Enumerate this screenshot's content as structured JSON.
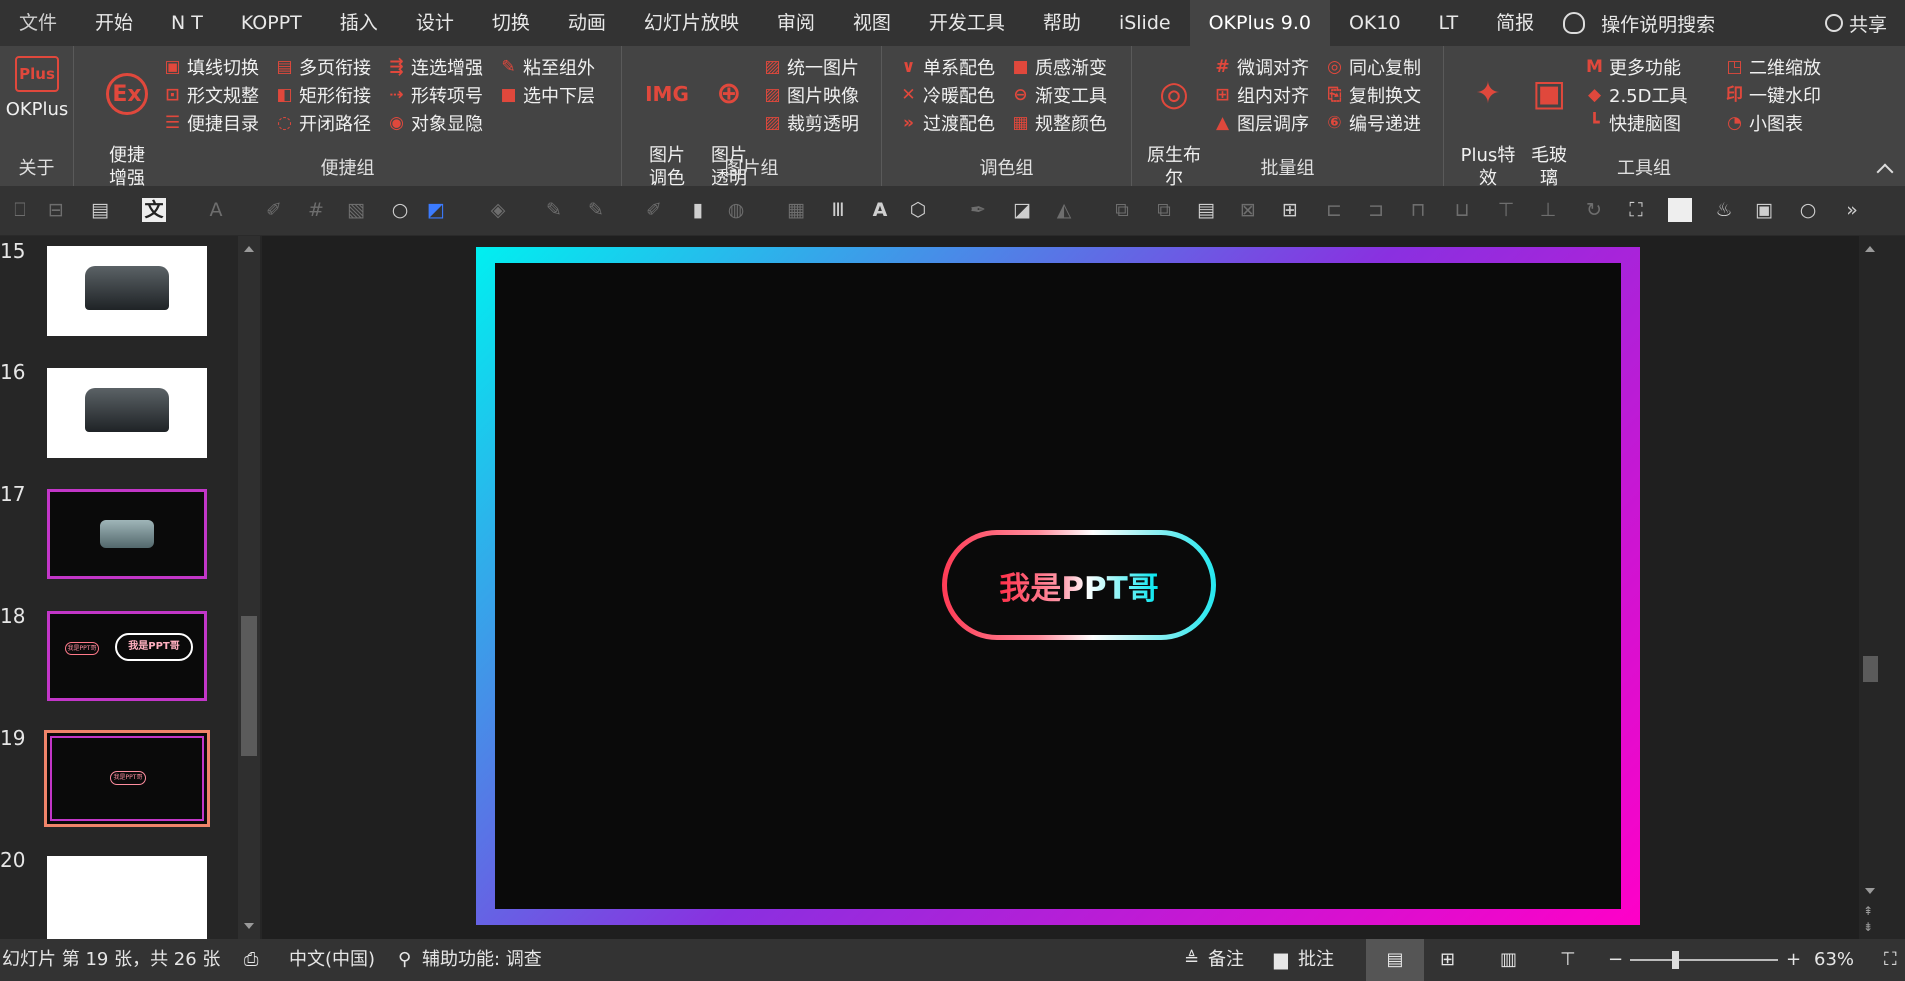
{
  "tabs": [
    "文件",
    "开始",
    "N T",
    "KOPPT",
    "插入",
    "设计",
    "切换",
    "动画",
    "幻灯片放映",
    "审阅",
    "视图",
    "开发工具",
    "帮助",
    "iSlide",
    "OKPlus 9.0",
    "OK10",
    "LT",
    "简报"
  ],
  "active_tab": "OKPlus 9.0",
  "help_search": "操作说明搜索",
  "share": "共享",
  "ribbon": {
    "about": {
      "button": "OKPlus",
      "label": "关于"
    },
    "bianjie": {
      "big": "便捷\n增强",
      "items": [
        "填线切换",
        "形文规整",
        "便捷目录",
        "多页衔接",
        "矩形衔接",
        "开闭路径",
        "连选增强",
        "形转项号",
        "对象显隐",
        "粘至组外",
        "选中下层"
      ],
      "label": "便捷组"
    },
    "tupian": {
      "big1": "图片\n调色",
      "big1_icon": "IMG",
      "big2": "图片\n透明",
      "items": [
        "统一图片",
        "图片映像",
        "裁剪透明"
      ],
      "label": "图片组"
    },
    "tiaose": {
      "items": [
        "单系配色",
        "冷暖配色",
        "过渡配色",
        "质感渐变",
        "渐变工具",
        "规整颜色"
      ],
      "label": "调色组"
    },
    "piliang": {
      "big": "原生布\n尔",
      "items": [
        "微调对齐",
        "组内对齐",
        "图层调序",
        "同心复制",
        "复制换文",
        "编号递进"
      ],
      "label": "批量组"
    },
    "gongju": {
      "big1": "Plus特\n效",
      "big2": "毛玻\n璃",
      "items": [
        "更多功能",
        "2.5D工具",
        "快捷脑图",
        "二维缩放",
        "一键水印",
        "小图表"
      ],
      "label": "工具组"
    }
  },
  "thumbnails": [
    {
      "num": "15",
      "style": "white-machine"
    },
    {
      "num": "16",
      "style": "white-machine"
    },
    {
      "num": "17",
      "style": "dark-machine"
    },
    {
      "num": "18",
      "style": "dark-buttons"
    },
    {
      "num": "19",
      "style": "dark-pill",
      "selected": true
    },
    {
      "num": "20",
      "style": "white-blank"
    }
  ],
  "thumb18_small": "我是PPT哥",
  "thumb18_big": "我是PPT哥",
  "thumb19_text": "我是PPT哥",
  "slide": {
    "pill_text": "我是PPT哥"
  },
  "status": {
    "slide_info": "幻灯片 第 19 张，共 26 张",
    "language": "中文(中国)",
    "accessibility": "辅助功能: 调查",
    "notes": "备注",
    "comments": "批注",
    "zoom": "63%"
  },
  "colors": {
    "accent": "#e0483c",
    "ribbon_bg": "#444444",
    "tabs_bg": "#333333",
    "slide_gradient_start": "#00f0f0",
    "slide_gradient_end": "#ff00c8",
    "selected_thumb_border": "#f0846a"
  }
}
